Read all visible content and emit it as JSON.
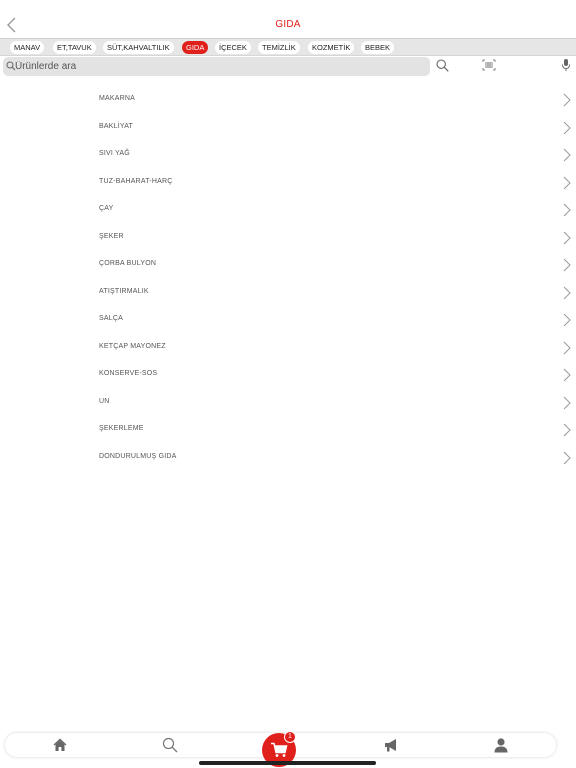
{
  "header": {
    "title": "GIDA"
  },
  "tabs": [
    {
      "label": "MANAV",
      "active": false
    },
    {
      "label": "ET,TAVUK",
      "active": false
    },
    {
      "label": "SÜT,KAHVALTILIK",
      "active": false
    },
    {
      "label": "GIDA",
      "active": true
    },
    {
      "label": "İÇECEK",
      "active": false
    },
    {
      "label": "TEMİZLİK",
      "active": false
    },
    {
      "label": "KOZMETİK",
      "active": false
    },
    {
      "label": "BEBEK",
      "active": false
    }
  ],
  "search": {
    "placeholder": "Ürünlerde ara",
    "value": ""
  },
  "categories": [
    "MAKARNA",
    "BAKLİYAT",
    "SIVI YAĞ",
    "TUZ-BAHARAT-HARÇ",
    "ÇAY",
    "ŞEKER",
    "ÇORBA BULYON",
    "ATIŞTIRMALIK",
    "SALÇA",
    "KETÇAP MAYONEZ",
    "KONSERVE-SOS",
    "UN",
    "ŞEKERLEME",
    "DONDURULMUŞ GIDA"
  ],
  "cart": {
    "count": "1"
  },
  "colors": {
    "accent": "#e0201b",
    "tab_bar": "#e6e6e6",
    "search_bg": "#e3e3e3"
  },
  "icons": {
    "back": "chevron-left-icon",
    "search": "search-icon",
    "barcode": "barcode-icon",
    "mic": "microphone-icon",
    "chevron": "chevron-right-icon",
    "home": "home-icon",
    "cart": "cart-icon",
    "campaign": "megaphone-icon",
    "profile": "user-icon"
  }
}
